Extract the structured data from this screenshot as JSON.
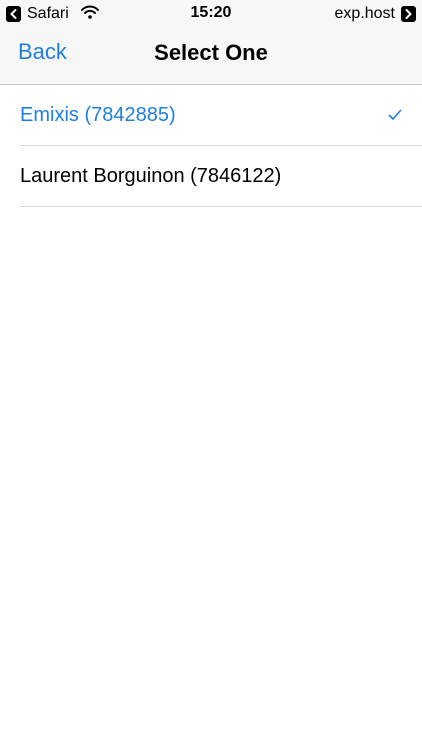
{
  "status_bar": {
    "back_app_label": "Safari",
    "time": "15:20",
    "host": "exp.host"
  },
  "nav": {
    "back_label": "Back",
    "title": "Select One"
  },
  "options": [
    {
      "label": "Emixis (7842885)",
      "selected": true
    },
    {
      "label": "Laurent Borguinon (7846122)",
      "selected": false
    }
  ],
  "colors": {
    "accent": "#1f7fe0",
    "bar_background": "#f7f7f7",
    "separator": "#d9d9d9"
  },
  "icons": [
    "back-to-app-icon",
    "wifi-icon",
    "forward-app-icon",
    "checkmark-icon"
  ]
}
